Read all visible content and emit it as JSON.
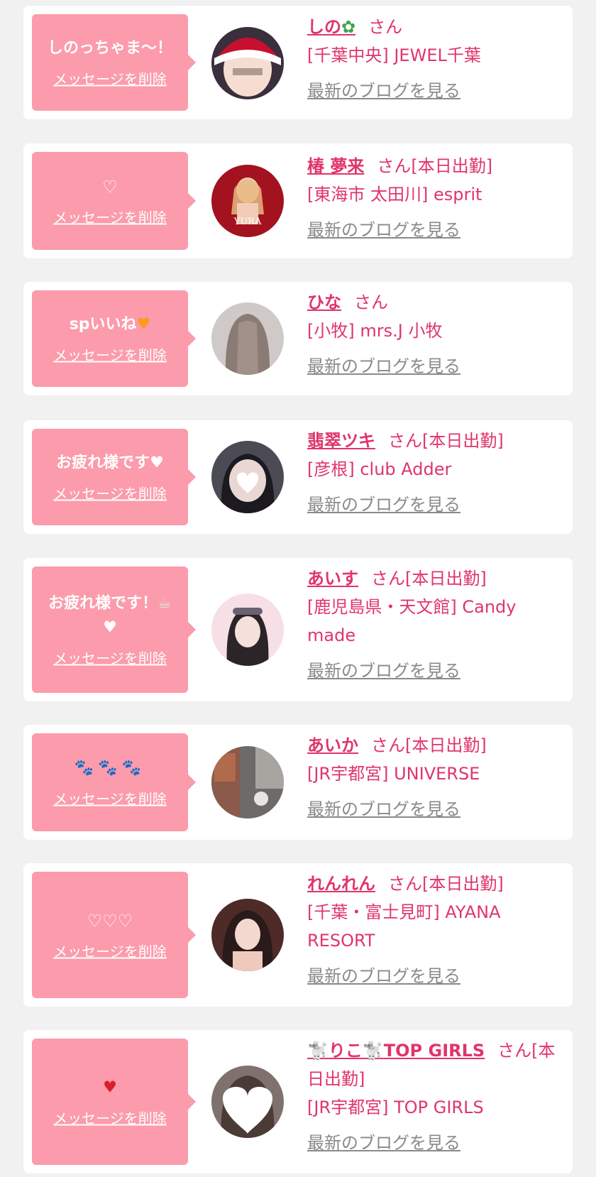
{
  "delete_label": "メッセージを削除",
  "blog_label": "最新のブログを見る",
  "entries": [
    {
      "message": "しのっちゃま〜！",
      "name": "しの",
      "name_icon": "sprout-icon",
      "suffix": "さん",
      "shop": "[千葉中央] JEWEL千葉"
    },
    {
      "message": "♡",
      "name": "椿 夢来",
      "suffix": "さん[本日出勤]",
      "shop": "[東海市 太田川] esprit",
      "avatar_text": "YURA"
    },
    {
      "message": "spいいね",
      "message_icon": "orange-heart-icon",
      "name": "ひな",
      "suffix": "さん",
      "shop": "[小牧] mrs.J 小牧"
    },
    {
      "message": "お疲れ様です",
      "message_icon": "white-heart-icon",
      "name": "翡翠ツキ",
      "suffix": "さん[本日出勤]",
      "shop": "[彦根] club Adder"
    },
    {
      "message": "お疲れ様です！",
      "message_icon": "tea-icon",
      "message_icon2": "white-heart-icon",
      "name": "あいす",
      "suffix": "さん[本日出勤]",
      "shop": "[鹿児島県・天文館] Candy made"
    },
    {
      "message": "",
      "message_icon": "paw-prints-icon",
      "name": "あいか",
      "suffix": "さん[本日出勤]",
      "shop": "[JR宇都宮] UNIVERSE"
    },
    {
      "message": "♡♡♡",
      "name": "れんれん",
      "suffix": "さん[本日出勤]",
      "shop": "[千葉・富士見町] AYANA RESORT"
    },
    {
      "message": "",
      "message_icon": "heart-on-fire-icon",
      "name": "りこ",
      "name_icon": "poodle-icon",
      "name_tail": "TOP GIRLS",
      "suffix": "さん[本日出勤]",
      "shop": "[JR宇都宮] TOP GIRLS"
    }
  ],
  "colors": {
    "bubble": "#fb9bab",
    "accent": "#e0356a",
    "muted": "#8a8a8a",
    "background": "#f1f1f1"
  }
}
